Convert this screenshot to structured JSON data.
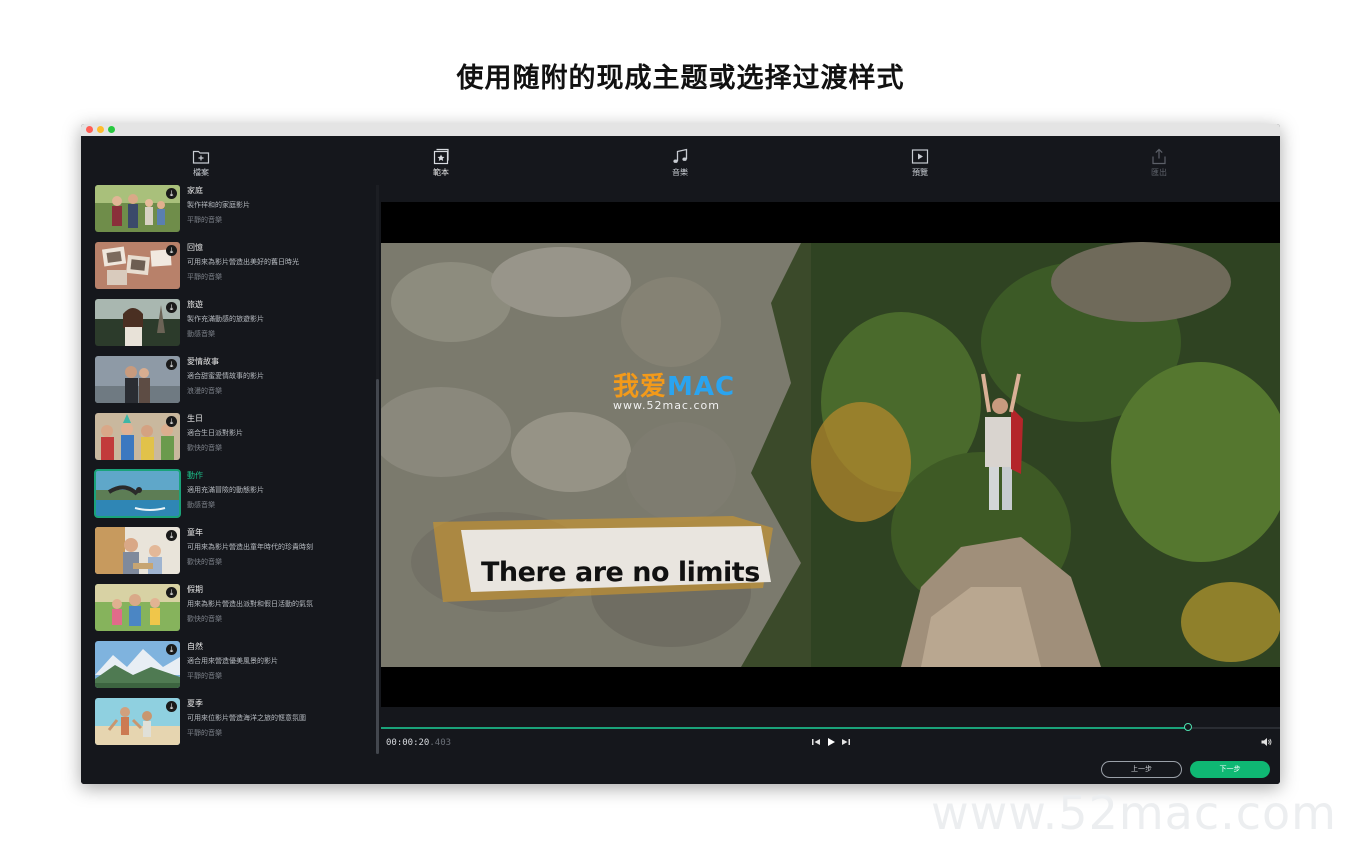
{
  "headline": "使用随附的现成主题或选择过渡样式",
  "nav": {
    "tabs": [
      {
        "label": "檔案",
        "icon": "folder-add-icon",
        "state": "normal"
      },
      {
        "label": "範本",
        "icon": "template-icon",
        "state": "active"
      },
      {
        "label": "音樂",
        "icon": "music-note-icon",
        "state": "normal"
      },
      {
        "label": "預覽",
        "icon": "play-preview-icon",
        "state": "normal"
      },
      {
        "label": "匯出",
        "icon": "export-icon",
        "state": "disabled"
      }
    ]
  },
  "templates": [
    {
      "name": "家庭",
      "desc": "製作祥和的家庭影片",
      "music": "平靜的音樂"
    },
    {
      "name": "回憶",
      "desc": "可用來為影片營造出美好的舊日時光",
      "music": "平靜的音樂"
    },
    {
      "name": "旅遊",
      "desc": "製作充滿動感的旅遊影片",
      "music": "動感音樂"
    },
    {
      "name": "愛情故事",
      "desc": "適合甜蜜愛情故事的影片",
      "music": "浪漫的音樂"
    },
    {
      "name": "生日",
      "desc": "適合生日派對影片",
      "music": "歡快的音樂"
    },
    {
      "name": "動作",
      "desc": "適用充滿冒險的動態影片",
      "music": "動感音樂"
    },
    {
      "name": "童年",
      "desc": "可用來為影片營造出童年時代的珍貴時刻",
      "music": "歡快的音樂"
    },
    {
      "name": "假期",
      "desc": "用來為影片營造出派對和假日活動的氣氛",
      "music": "歡快的音樂"
    },
    {
      "name": "自然",
      "desc": "適合用來營造優美風景的影片",
      "music": "平靜的音樂"
    },
    {
      "name": "夏季",
      "desc": "可用來位影片營造海洋之旅的愜意氛圍",
      "music": "平靜的音樂"
    }
  ],
  "selected_template": "動作",
  "player": {
    "caption": "There are no limits",
    "timecode_main": "00:00:20",
    "timecode_ms": ".403",
    "progress": 0.898
  },
  "overlay_watermark": {
    "big_a": "我爱",
    "big_b": "MAC",
    "url": "www.52mac.com"
  },
  "footer": {
    "prev_label": "上一步",
    "next_label": "下一步"
  },
  "page_watermark": "www.52mac.com",
  "colors": {
    "accent": "#1aa37a",
    "next_button": "#0fb873",
    "background": "#15171c"
  }
}
